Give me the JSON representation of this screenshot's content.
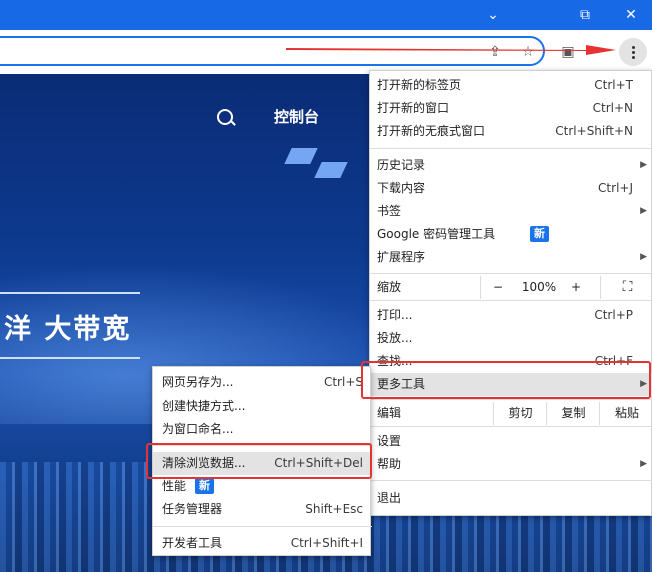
{
  "window": {
    "minimize": "⌄",
    "restore": "⧉",
    "close": "✕"
  },
  "toolbar": {
    "share_icon": "share-icon",
    "star_icon": "star-icon",
    "sidebar_icon": "sidebar-icon",
    "menu_icon": "more-vert-icon"
  },
  "page": {
    "console": "控制台",
    "hero": "洋 大带宽"
  },
  "menu": {
    "new_tab": {
      "label": "打开新的标签页",
      "shortcut": "Ctrl+T"
    },
    "new_window": {
      "label": "打开新的窗口",
      "shortcut": "Ctrl+N"
    },
    "incognito": {
      "label": "打开新的无痕式窗口",
      "shortcut": "Ctrl+Shift+N"
    },
    "history": {
      "label": "历史记录"
    },
    "downloads": {
      "label": "下载内容",
      "shortcut": "Ctrl+J"
    },
    "bookmarks": {
      "label": "书签"
    },
    "passwords": {
      "label": "Google 密码管理工具",
      "badge": "新"
    },
    "extensions": {
      "label": "扩展程序"
    },
    "zoom": {
      "label": "缩放",
      "minus": "−",
      "value": "100%",
      "plus": "+"
    },
    "print": {
      "label": "打印...",
      "shortcut": "Ctrl+P"
    },
    "cast": {
      "label": "投放..."
    },
    "find": {
      "label": "查找...",
      "shortcut": "Ctrl+F"
    },
    "more_tools": {
      "label": "更多工具"
    },
    "edit": {
      "label": "编辑",
      "cut": "剪切",
      "copy": "复制",
      "paste": "粘贴"
    },
    "settings": {
      "label": "设置"
    },
    "help": {
      "label": "帮助"
    },
    "exit": {
      "label": "退出"
    }
  },
  "submenu": {
    "save_as": {
      "label": "网页另存为...",
      "shortcut": "Ctrl+S"
    },
    "shortcut": {
      "label": "创建快捷方式..."
    },
    "name_window": {
      "label": "为窗口命名..."
    },
    "clear_data": {
      "label": "清除浏览数据...",
      "shortcut": "Ctrl+Shift+Del"
    },
    "performance": {
      "label": "性能",
      "badge": "新"
    },
    "task_manager": {
      "label": "任务管理器",
      "shortcut": "Shift+Esc"
    },
    "devtools": {
      "label": "开发者工具",
      "shortcut": "Ctrl+Shift+I"
    }
  },
  "colors": {
    "accent": "#1a73e8",
    "highlight": "#e53232",
    "titlebar": "#1769e6"
  }
}
